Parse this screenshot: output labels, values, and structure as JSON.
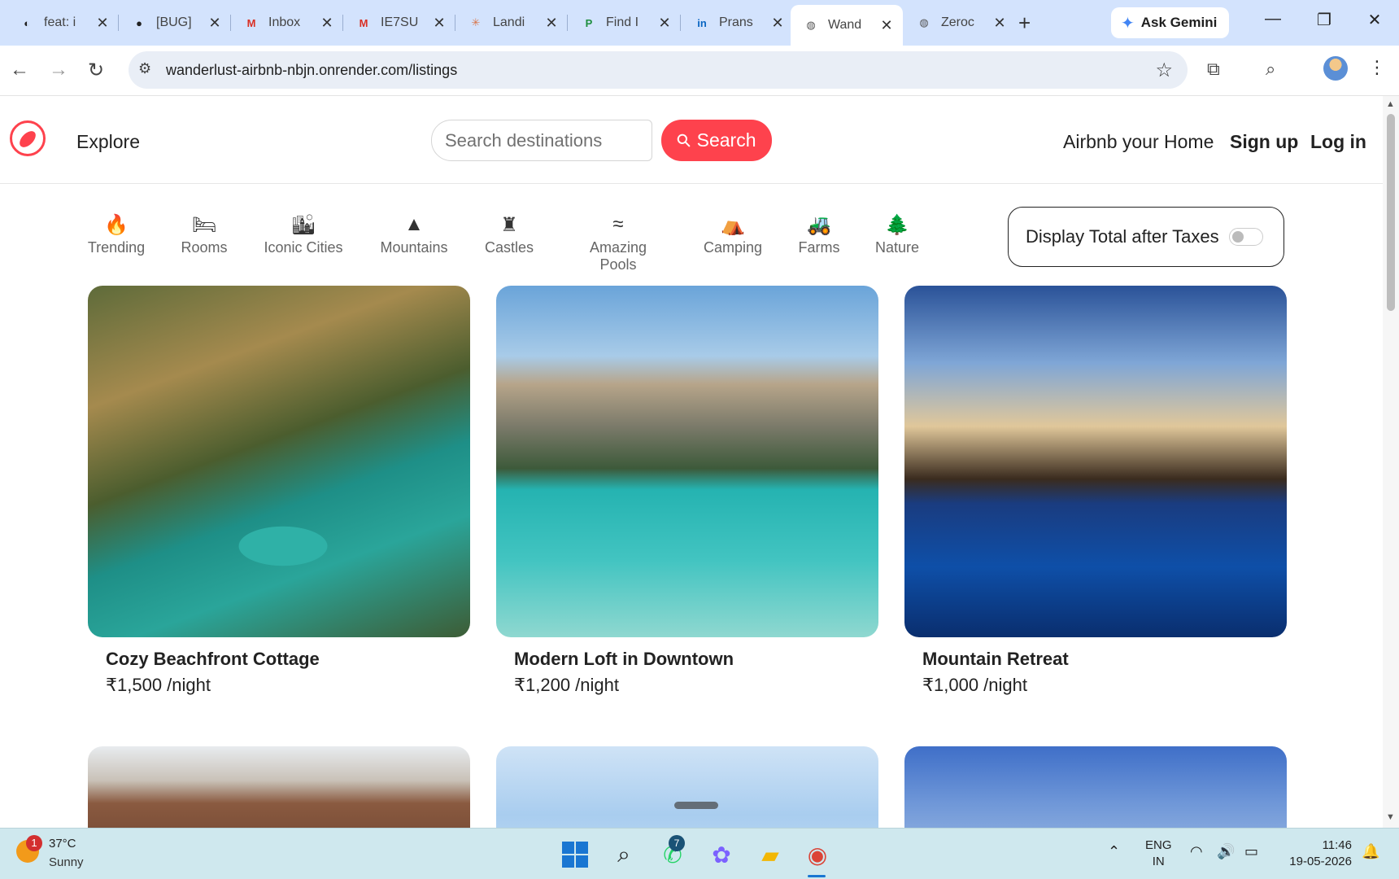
{
  "browser": {
    "tabs": [
      {
        "title": "feat: i",
        "icon": "github-x-icon",
        "icon_glyph": "◐",
        "icon_color": "#222"
      },
      {
        "title": "[BUG]",
        "icon": "github-icon",
        "icon_glyph": "●",
        "icon_color": "#222"
      },
      {
        "title": "Inbox",
        "icon": "gmail-icon",
        "icon_glyph": "M",
        "icon_color": "#d93025"
      },
      {
        "title": "IE7SU",
        "icon": "gmail-icon",
        "icon_glyph": "M",
        "icon_color": "#d93025"
      },
      {
        "title": "Landi",
        "icon": "claude-icon",
        "icon_glyph": "✳",
        "icon_color": "#d9764a"
      },
      {
        "title": "Find I",
        "icon": "p-app-icon",
        "icon_glyph": "P",
        "icon_color": "#1e8e3e"
      },
      {
        "title": "Prans",
        "icon": "linkedin-icon",
        "icon_glyph": "in",
        "icon_color": "#0a66c2"
      },
      {
        "title": "Wand",
        "icon": "globe-icon",
        "icon_glyph": "◍",
        "icon_color": "#555",
        "active": true
      },
      {
        "title": "Zeroc",
        "icon": "globe-icon",
        "icon_glyph": "◍",
        "icon_color": "#555"
      }
    ],
    "new_tab": "+",
    "gemini_label": "Ask Gemini",
    "url": "wanderlust-airbnb-nbjn.onrender.com/listings",
    "window_controls": {
      "minimize": "—",
      "restore": "❐",
      "close": "✕"
    }
  },
  "site": {
    "explore": "Explore",
    "search_placeholder": "Search destinations",
    "search_button": "Search",
    "host_link": "Airbnb your Home",
    "signup": "Sign up",
    "login": "Log in"
  },
  "filters": [
    {
      "label": "Trending",
      "icon": "fire-icon",
      "glyph": "🔥"
    },
    {
      "label": "Rooms",
      "icon": "bed-icon",
      "glyph": "🛏"
    },
    {
      "label": "Iconic Cities",
      "icon": "city-icon",
      "glyph": "🏙"
    },
    {
      "label": "Mountains",
      "icon": "mountain-icon",
      "glyph": "▲"
    },
    {
      "label": "Castles",
      "icon": "castle-icon",
      "glyph": "♜"
    },
    {
      "label": "Amazing Pools",
      "icon": "pool-icon",
      "glyph": "≈"
    },
    {
      "label": "Camping",
      "icon": "campground-icon",
      "glyph": "⛺"
    },
    {
      "label": "Farms",
      "icon": "tractor-icon",
      "glyph": "🚜"
    },
    {
      "label": "Nature",
      "icon": "tree-icon",
      "glyph": "🌲"
    }
  ],
  "tax_toggle": {
    "label": "Display Total after Taxes",
    "checked": false
  },
  "listings": [
    {
      "title": "Cozy Beachfront Cottage",
      "price": "₹1,500 /night",
      "image": "palm-river-image"
    },
    {
      "title": "Modern Loft in Downtown",
      "price": "₹1,200 /night",
      "image": "mountain-lake-image"
    },
    {
      "title": "Mountain Retreat",
      "price": "₹1,000 /night",
      "image": "resort-pool-image"
    },
    {
      "title": "",
      "price": "",
      "image": "cabin-roof-image"
    },
    {
      "title": "",
      "price": "",
      "image": "sky-image"
    },
    {
      "title": "",
      "price": "",
      "image": "beach-palm-image"
    }
  ],
  "taskbar": {
    "weather_badge": "1",
    "temperature": "37°C",
    "condition": "Sunny",
    "whatsapp_badge": "7",
    "lang_top": "ENG",
    "lang_bottom": "IN",
    "time": "11:46",
    "date": "19-05-2026"
  },
  "colors": {
    "brand": "#fe424d",
    "tab_strip": "#d3e3fd",
    "taskbar": "#cfe8ee"
  }
}
